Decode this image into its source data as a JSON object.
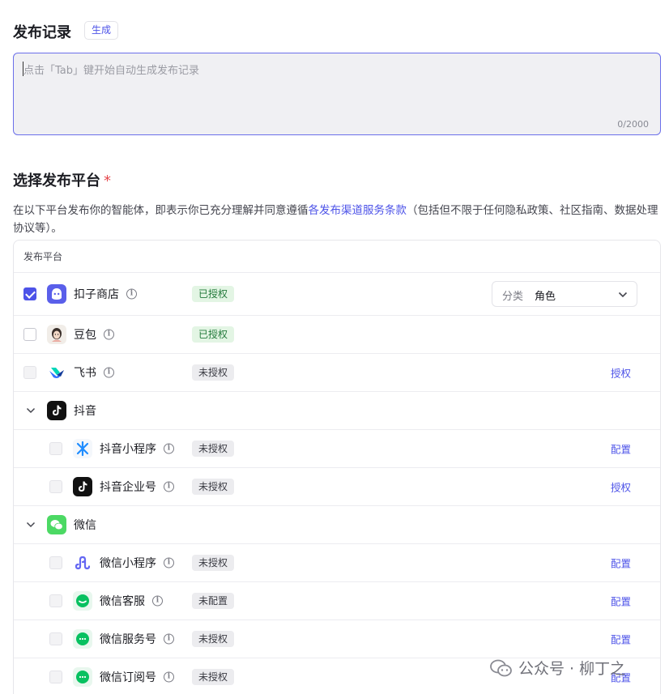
{
  "release_section": {
    "title": "发布记录",
    "generate_button": "生成",
    "placeholder": "点击「Tab」键开始自动生成发布记录",
    "counter": "0/2000"
  },
  "platform_section": {
    "title": "选择发布平台",
    "required_mark": "*",
    "description_before": "在以下平台发布你的智能体，即表示你已充分理解并同意遵循",
    "description_link": "各发布渠道服务条款",
    "description_after": "（包括但不限于任何隐私政策、社区指南、数据处理协议等）。",
    "table_header": "发布平台"
  },
  "rows": [
    {
      "name": "扣子商店",
      "status": "已授权",
      "action": "",
      "checked": true,
      "select_label": "分类",
      "select_value": "角色",
      "icon": "coze-store-icon"
    },
    {
      "name": "豆包",
      "status": "已授权",
      "action": "",
      "checked": false,
      "icon": "doubao-icon"
    },
    {
      "name": "飞书",
      "status": "未授权",
      "action": "授权",
      "checked": false,
      "icon": "feishu-icon"
    },
    {
      "name": "抖音",
      "group": true,
      "icon": "douyin-icon"
    },
    {
      "name": "抖音小程序",
      "status": "未授权",
      "action": "配置",
      "icon": "douyin-miniapp-icon"
    },
    {
      "name": "抖音企业号",
      "status": "未授权",
      "action": "授权",
      "icon": "douyin-enterprise-icon"
    },
    {
      "name": "微信",
      "group": true,
      "icon": "wechat-icon"
    },
    {
      "name": "微信小程序",
      "status": "未授权",
      "action": "配置",
      "icon": "wechat-miniapp-icon"
    },
    {
      "name": "微信客服",
      "status": "未配置",
      "action": "配置",
      "icon": "wechat-service-icon"
    },
    {
      "name": "微信服务号",
      "status": "未授权",
      "action": "配置",
      "icon": "wechat-service-account-icon"
    },
    {
      "name": "微信订阅号",
      "status": "未授权",
      "action": "配置",
      "icon": "wechat-subscription-icon"
    }
  ],
  "watermark": {
    "text": "公众号 · 柳丁之"
  },
  "colors": {
    "accent": "#4d53e8",
    "authorized_bg": "#e3f5e4",
    "wechat_green": "#07c160"
  }
}
